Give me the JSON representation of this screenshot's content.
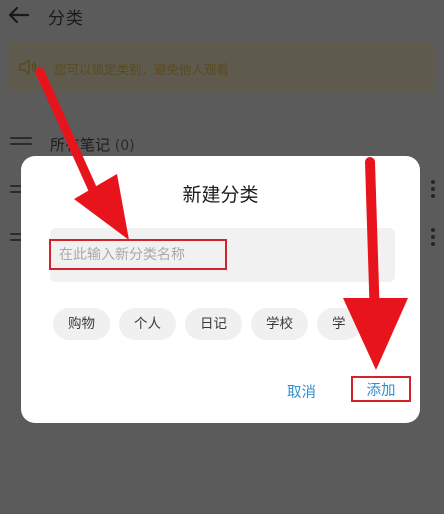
{
  "header": {
    "title": "分类",
    "back_icon": "arrow-left-icon"
  },
  "notice": {
    "icon": "speaker-icon",
    "text": "您可以锁定类别，避免他人观看"
  },
  "list": {
    "all_notes_label": "所有笔记",
    "all_notes_count": "(0)"
  },
  "dialog": {
    "title": "新建分类",
    "input_placeholder": "在此输入新分类名称",
    "input_value": "",
    "chips": [
      "购物",
      "个人",
      "日记",
      "学校",
      "学"
    ],
    "cancel_label": "取消",
    "add_label": "添加"
  },
  "colors": {
    "accent": "#2f8fd0",
    "annotation_red": "#d3222a",
    "overlay": "#5b5b5b"
  }
}
